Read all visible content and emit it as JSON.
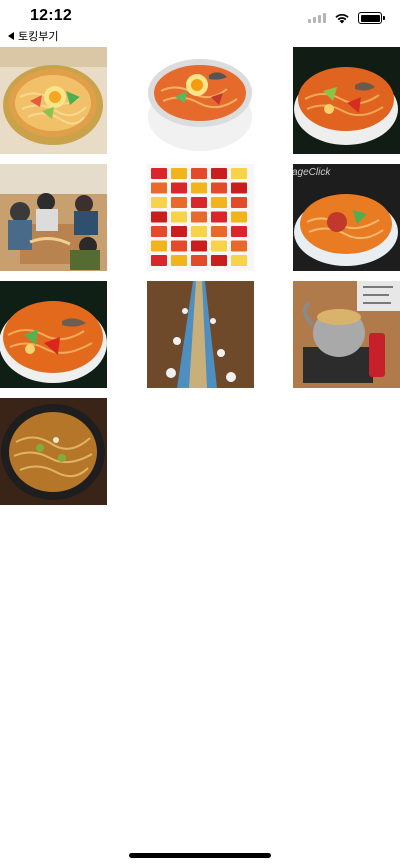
{
  "status_bar": {
    "time": "12:12",
    "icons": [
      "cellular-signal-icon",
      "wifi-icon",
      "battery-icon"
    ]
  },
  "nav": {
    "back_label": "토킹부기"
  },
  "grid": {
    "columns": 3,
    "images": [
      {
        "name": "ramen-pot-egg-image",
        "icon": "ramen-in-pot"
      },
      {
        "name": "ramen-bowl-egg-image",
        "icon": "ramen-in-bowl"
      },
      {
        "name": "ramen-bowl-chili-image",
        "icon": "ramen-in-bowl"
      },
      {
        "name": "children-eating-noodles-image",
        "icon": "people-eating"
      },
      {
        "name": "ramen-packages-image",
        "icon": "product-packages"
      },
      {
        "name": "ramen-bowl-watermark-image",
        "icon": "ramen-in-bowl",
        "watermark": "ageClick"
      },
      {
        "name": "ramen-bowl-closeup-image",
        "icon": "ramen-in-bowl"
      },
      {
        "name": "long-ramen-table-image",
        "icon": "long-table"
      },
      {
        "name": "ramen-kettle-image",
        "icon": "kettle-on-stove"
      },
      {
        "name": "ramen-stone-bowl-image",
        "icon": "ramen-in-stone-bowl"
      }
    ]
  }
}
